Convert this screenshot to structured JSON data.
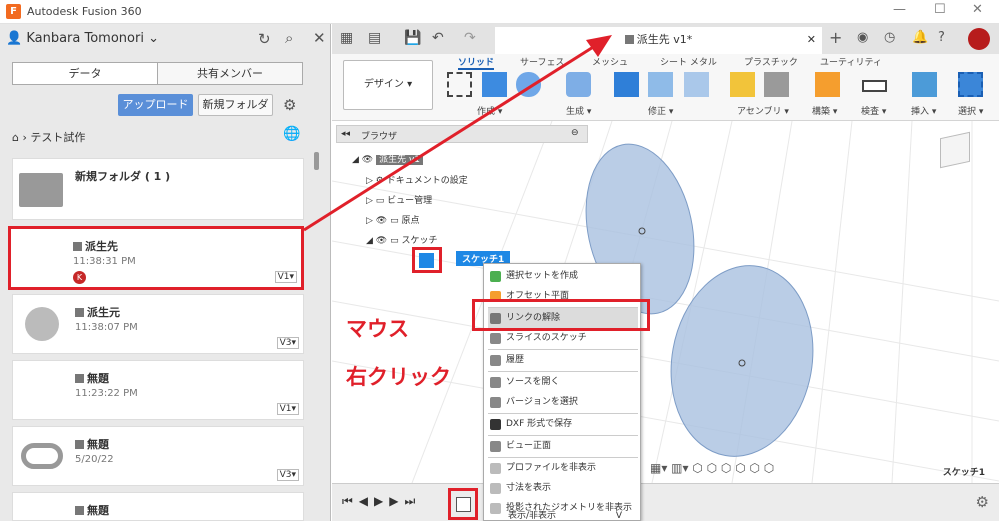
{
  "app": {
    "title": "Autodesk Fusion 360",
    "logo_letter": "F"
  },
  "account": {
    "name": "Kanbara Tomonori"
  },
  "panel_tabs": [
    "データ",
    "共有メンバー"
  ],
  "panel_buttons": {
    "upload": "アップロード",
    "new_folder": "新規フォルダ"
  },
  "breadcrumb": "テスト試作",
  "files": [
    {
      "name": "新規フォルダ ( 1 )",
      "time": "",
      "version": ""
    },
    {
      "name": "派生先",
      "time": "11:38:31 PM",
      "version": "V1▾"
    },
    {
      "name": "派生元",
      "time": "11:38:07 PM",
      "version": "V3▾"
    },
    {
      "name": "無題",
      "time": "11:23:22 PM",
      "version": "V1▾"
    },
    {
      "name": "無題",
      "time": "5/20/22",
      "version": "V3▾"
    },
    {
      "name": "無題",
      "time": "",
      "version": ""
    }
  ],
  "doc_tab": {
    "title": "派生先 v1*"
  },
  "workspace": "デザイン ▾",
  "ribbon_tabs": [
    "ソリッド",
    "サーフェス",
    "メッシュ",
    "シート メタル",
    "プラスチック",
    "ユーティリティ"
  ],
  "ribbon_groups": [
    "作成 ▾",
    "生成 ▾",
    "修正 ▾",
    "アセンブリ ▾",
    "構築 ▾",
    "検査 ▾",
    "挿入 ▾",
    "選択 ▾"
  ],
  "browser": {
    "header": "ブラウザ",
    "root": "派生先 v1",
    "items": [
      "ドキュメントの設定",
      "ビュー管理",
      "原点",
      "スケッチ"
    ],
    "sketch": "スケッチ1"
  },
  "context_menu": [
    "選択セットを作成",
    "オフセット平面",
    "リンクの解除",
    "スライスのスケッチ",
    "履歴",
    "ソースを開く",
    "バージョンを選択",
    "DXF 形式で保存",
    "ビュー正面",
    "プロファイルを非表示",
    "寸法を表示",
    "投影されたジオメトリを非表示",
    "表示/非表示"
  ],
  "context_menu_shortcut": "V",
  "annotation": {
    "line1": "マウス",
    "line2": "右クリック"
  },
  "status": {
    "sketch_label": "スケッチ1"
  },
  "user_initial": "K",
  "colors": {
    "accent": "#5a8fd8",
    "highlight": "#e0202a",
    "sketch_fill": "#9fb8d9"
  }
}
